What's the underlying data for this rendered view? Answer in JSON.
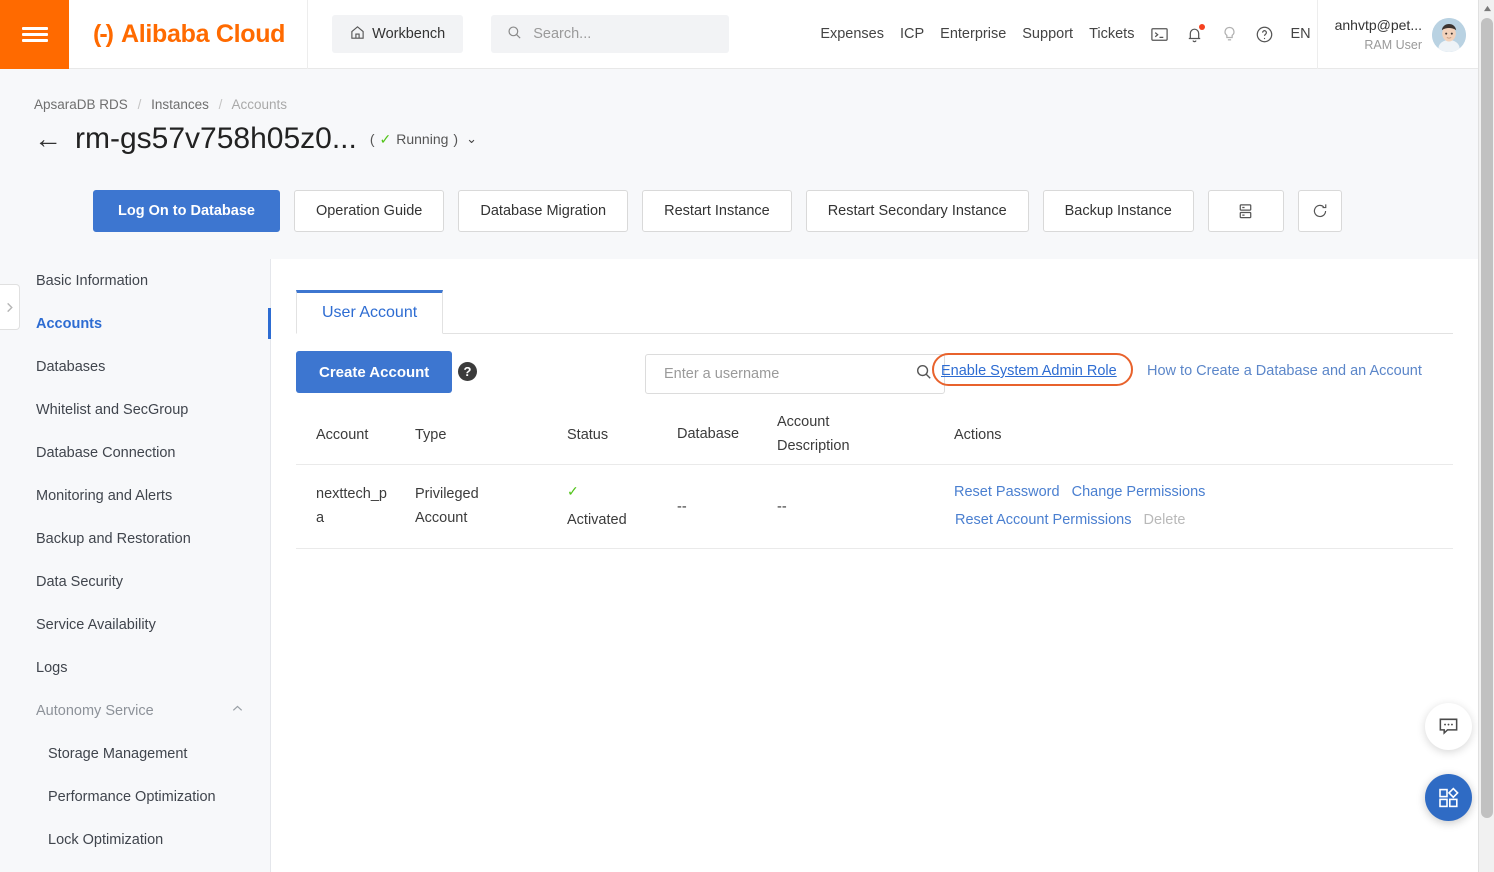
{
  "header": {
    "menu_icon": "hamburger-icon",
    "brand_mark": "(-)",
    "brand_name": "Alibaba Cloud",
    "workbench_label": "Workbench",
    "workbench_icon": "home-icon",
    "search_placeholder": "Search...",
    "search_icon": "search-icon",
    "nav_items": [
      {
        "label": "Expenses"
      },
      {
        "label": "ICP"
      },
      {
        "label": "Enterprise"
      },
      {
        "label": "Support"
      },
      {
        "label": "Tickets"
      }
    ],
    "icons": [
      {
        "name": "terminal-icon"
      },
      {
        "name": "bell-icon",
        "badge": true
      },
      {
        "name": "lightbulb-icon"
      },
      {
        "name": "help-circle-icon"
      }
    ],
    "language": "EN",
    "user_name": "anhvtp@pet...",
    "user_role": "RAM User",
    "avatar_icon": "avatar"
  },
  "breadcrumb": {
    "items": [
      "ApsaraDB RDS",
      "Instances",
      "Accounts"
    ],
    "separator": "/"
  },
  "page": {
    "back_icon": "back-arrow-icon",
    "title": "rm-gs57v758h05z0...",
    "status_open": "(",
    "status_tick": "✓",
    "status_text": "Running",
    "status_close": ")",
    "status_caret": "⌄"
  },
  "actions": {
    "primary": "Log On to Database",
    "buttons": [
      "Operation Guide",
      "Database Migration",
      "Restart Instance",
      "Restart Secondary Instance",
      "Backup Instance"
    ],
    "list_icon": "server-list-icon",
    "refresh_icon": "refresh-icon"
  },
  "sidebar": {
    "items": [
      {
        "label": "Basic Information",
        "active": false
      },
      {
        "label": "Accounts",
        "active": true
      },
      {
        "label": "Databases",
        "active": false
      },
      {
        "label": "Whitelist and SecGroup",
        "active": false
      },
      {
        "label": "Database Connection",
        "active": false
      },
      {
        "label": "Monitoring and Alerts",
        "active": false
      },
      {
        "label": "Backup and Restoration",
        "active": false
      },
      {
        "label": "Data Security",
        "active": false
      },
      {
        "label": "Service Availability",
        "active": false
      },
      {
        "label": "Logs",
        "active": false
      }
    ],
    "group": {
      "label": "Autonomy Service",
      "chevron": "⌃"
    },
    "subitems": [
      {
        "label": "Storage Management"
      },
      {
        "label": "Performance Optimization"
      },
      {
        "label": "Lock Optimization"
      }
    ],
    "toggle_icon": "chevron-right-icon"
  },
  "main": {
    "tabs": [
      {
        "label": "User Account",
        "active": true
      }
    ],
    "create_button": "Create Account",
    "help_icon_char": "?",
    "search_placeholder": "Enter a username",
    "search_icon": "search-icon",
    "admin_link": "Enable System Admin Role",
    "howto_link": "How to Create a Database and an Account",
    "highlight_color": "#e8622c"
  },
  "table": {
    "columns": [
      {
        "label": "Account"
      },
      {
        "label": "Type"
      },
      {
        "label": "Status"
      },
      {
        "label": "Database"
      },
      {
        "label": "Account Description"
      },
      {
        "label": "Actions"
      }
    ],
    "rows": [
      {
        "account": "nexttech_pa",
        "type": "Privileged Account",
        "status_tick": "✓",
        "status": "Activated",
        "database": "--",
        "description": "--",
        "actions_row1": [
          {
            "label": "Reset Password",
            "disabled": false
          },
          {
            "label": "Change Permissions",
            "disabled": false
          }
        ],
        "actions_row2": [
          {
            "label": "Reset Account Permissions",
            "disabled": false
          },
          {
            "label": "Delete",
            "disabled": true
          }
        ]
      }
    ]
  },
  "floating": {
    "chat_icon": "chat-bubble-icon",
    "apps_icon": "apps-grid-icon"
  },
  "colors": {
    "brand_orange": "#ff6a00",
    "primary_blue": "#3d76d0",
    "link_blue": "#2d6cd2",
    "success_green": "#52c41a",
    "highlight_orange": "#e8622c"
  }
}
